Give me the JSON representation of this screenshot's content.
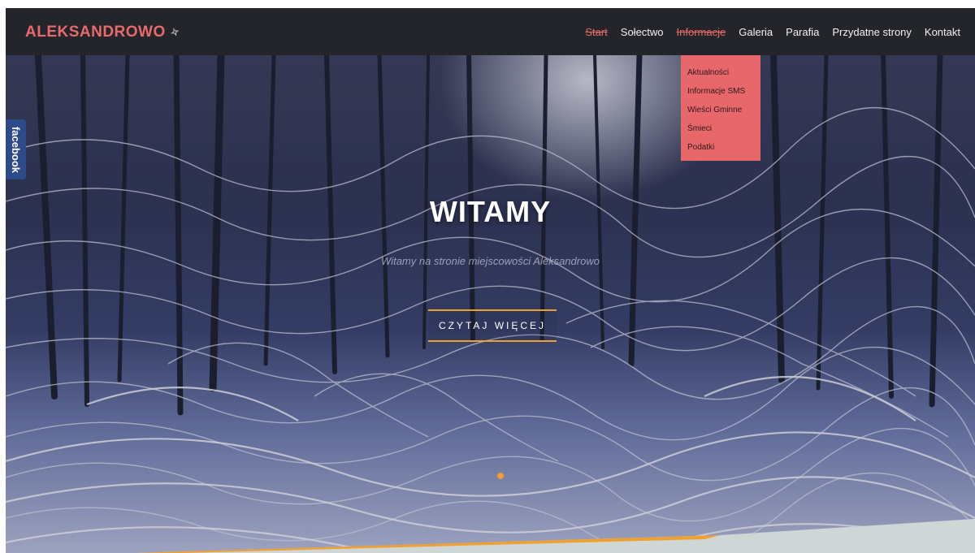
{
  "header": {
    "logo": "ALEKSANDROWO"
  },
  "nav": {
    "items": [
      {
        "label": "Start"
      },
      {
        "label": "Sołectwo"
      },
      {
        "label": "Informacje"
      },
      {
        "label": "Galeria"
      },
      {
        "label": "Parafia"
      },
      {
        "label": "Przydatne strony"
      },
      {
        "label": "Kontakt"
      }
    ]
  },
  "dropdown": {
    "items": [
      {
        "label": "Aktualności"
      },
      {
        "label": "Informacje SMS"
      },
      {
        "label": "Wieści Gminne"
      },
      {
        "label": "Śmieci"
      },
      {
        "label": "Podatki"
      }
    ]
  },
  "hero": {
    "title": "WITAMY",
    "subtitle": "Witamy na stronie miejscowości Aleksandrowo",
    "cta_label": "CZYTAJ WIĘCEJ"
  },
  "social": {
    "facebook_label": "facebook"
  },
  "colors": {
    "accent": "#e86a6a",
    "header_bg": "#23252a",
    "cta_border": "#f0a030",
    "facebook": "#2d4a8a"
  },
  "icons": {
    "logo_mark": "leaf-icon"
  }
}
